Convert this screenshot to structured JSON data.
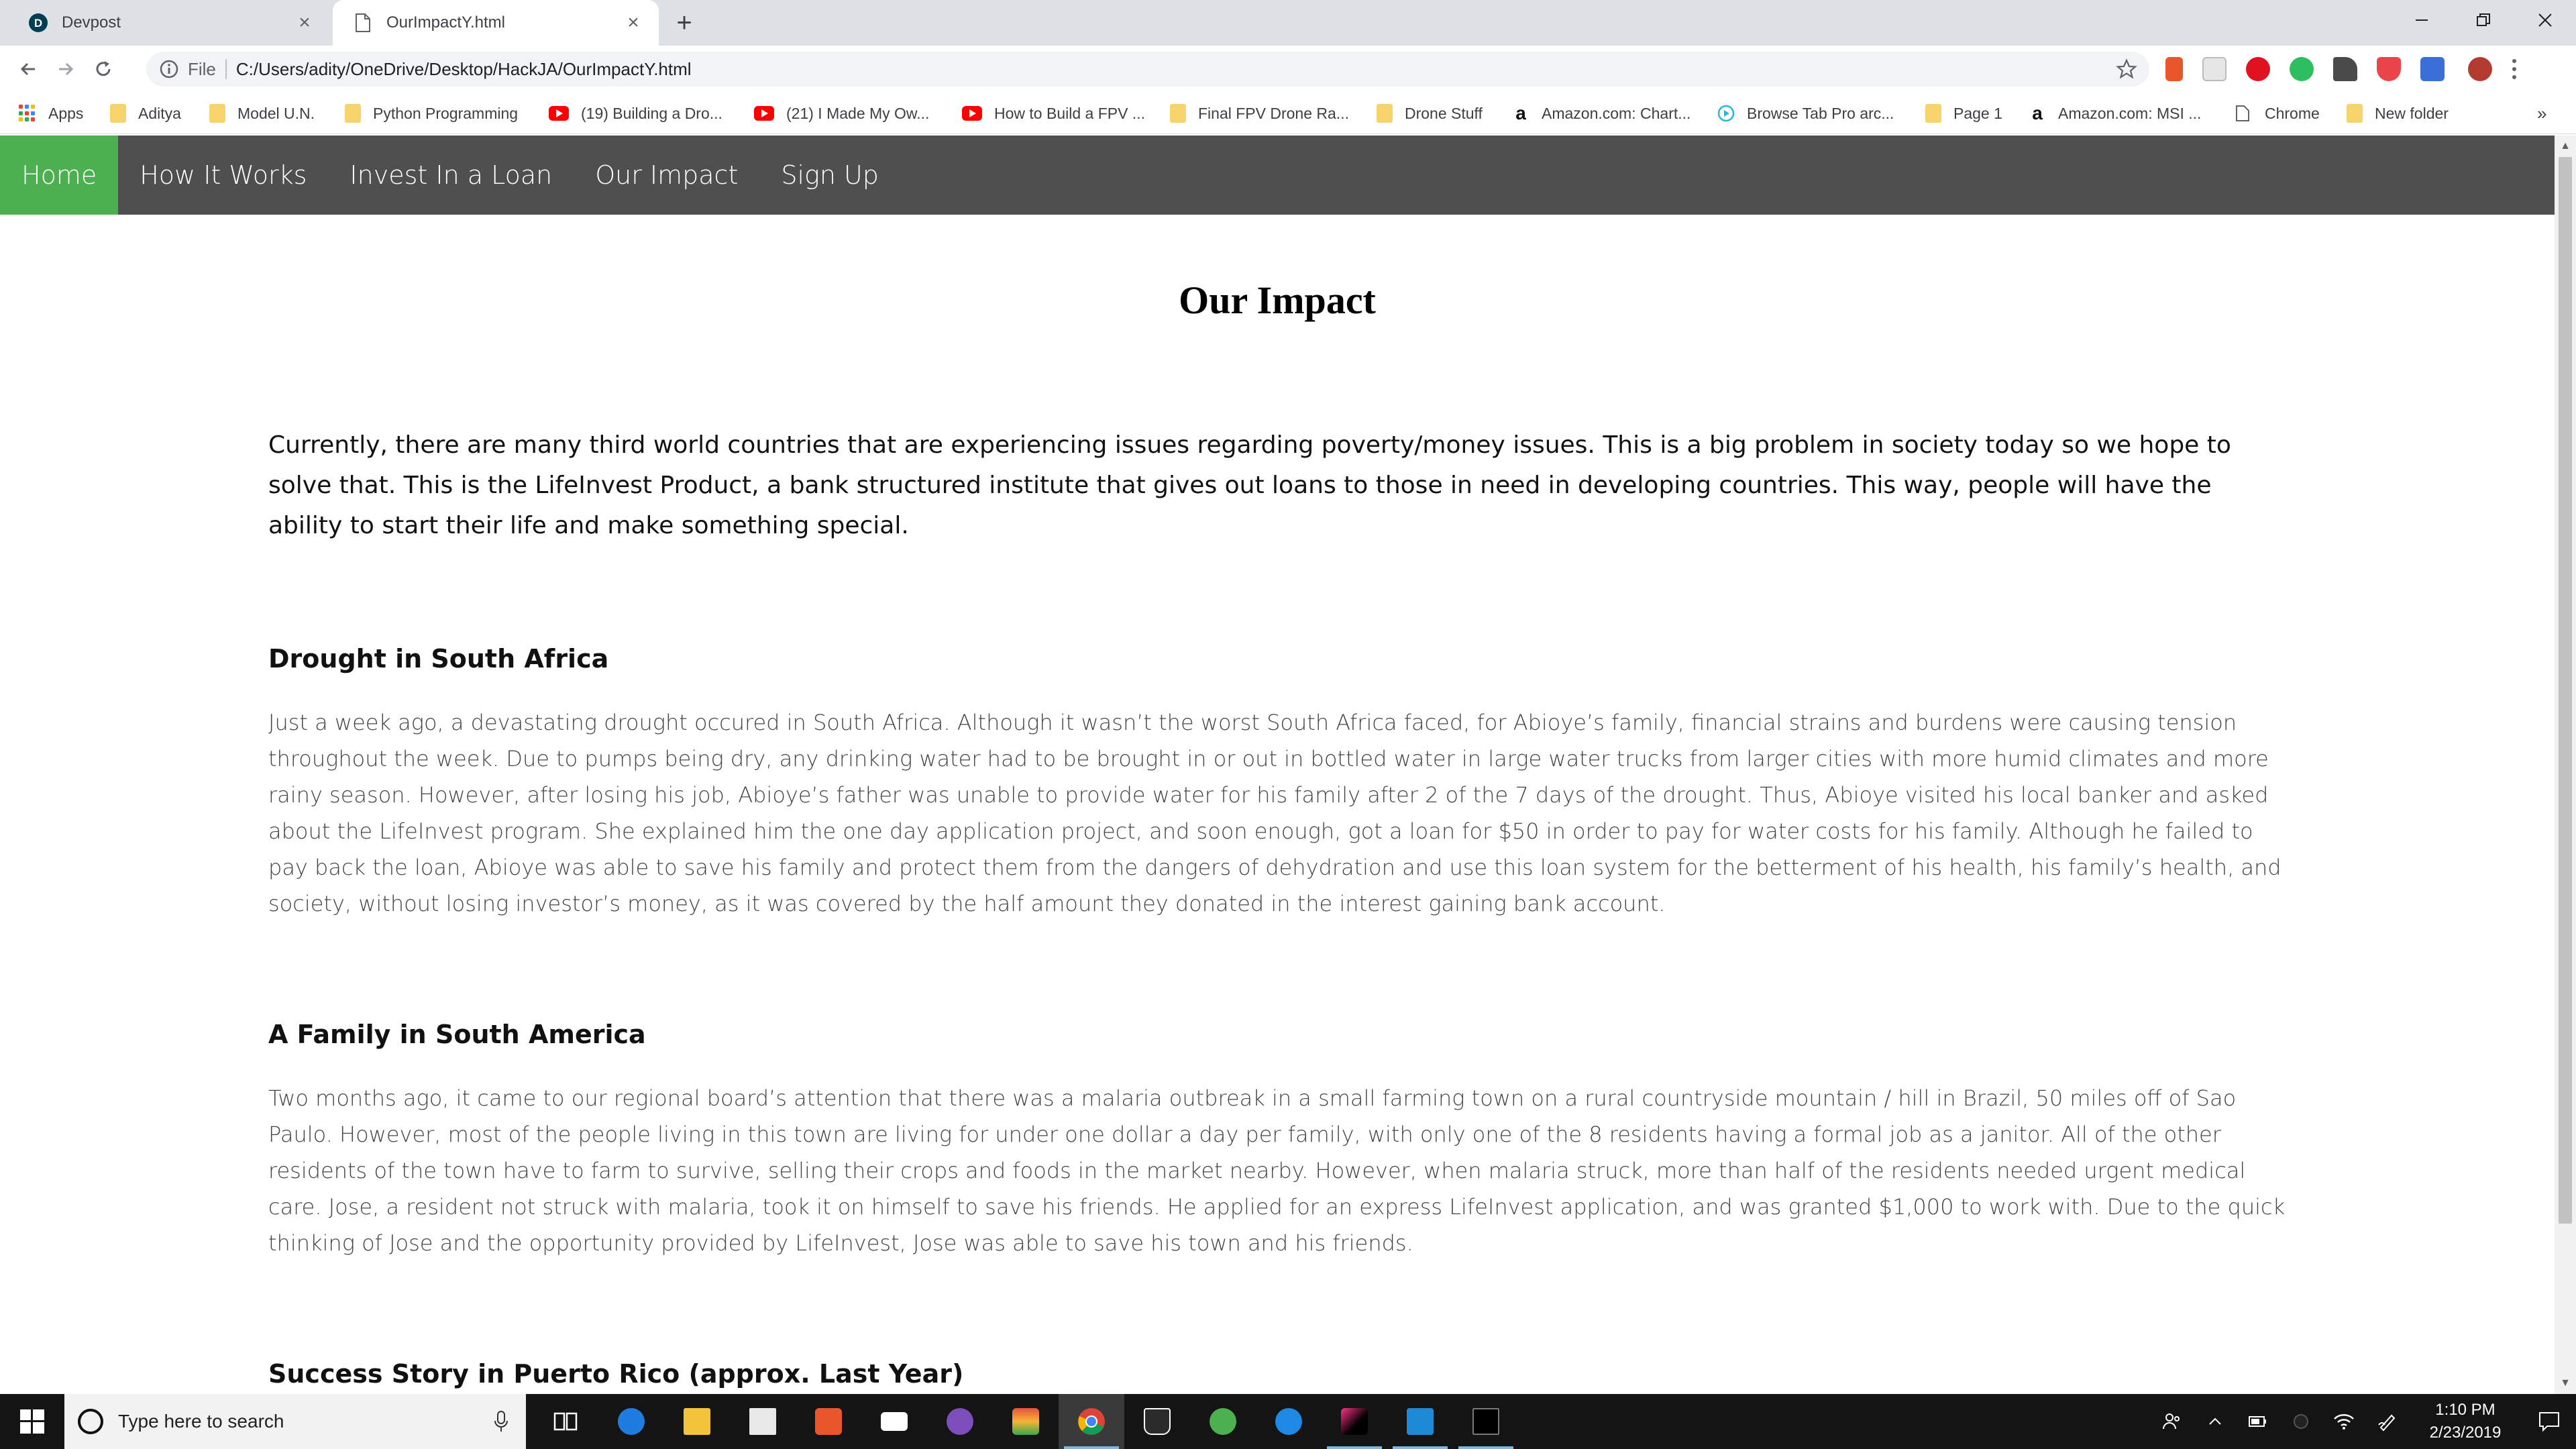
{
  "browser": {
    "tabs": [
      {
        "title": "Devpost",
        "active": false,
        "icon": "devpost-icon"
      },
      {
        "title": "OurImpactY.html",
        "active": true,
        "icon": "page-icon"
      }
    ],
    "new_tab_label": "+",
    "address": {
      "scheme": "File",
      "url": "C:/Users/adity/OneDrive/Desktop/HackJA/OurImpactY.html"
    },
    "bookmarks": [
      {
        "label": "Apps",
        "icon": "apps-grid-icon"
      },
      {
        "label": "Aditya",
        "icon": "folder-icon"
      },
      {
        "label": "Model U.N.",
        "icon": "folder-icon"
      },
      {
        "label": "Python Programming",
        "icon": "folder-icon"
      },
      {
        "label": "(19) Building a Dro...",
        "icon": "youtube-icon"
      },
      {
        "label": "(21) I Made My Ow...",
        "icon": "youtube-icon"
      },
      {
        "label": "How to Build a FPV ...",
        "icon": "youtube-icon"
      },
      {
        "label": "Final FPV Drone Ra...",
        "icon": "folder-icon"
      },
      {
        "label": "Drone Stuff",
        "icon": "folder-icon"
      },
      {
        "label": "Amazon.com: Chart...",
        "icon": "amazon-icon"
      },
      {
        "label": "Browse Tab Pro arc...",
        "icon": "play-circle-icon"
      },
      {
        "label": "Page 1",
        "icon": "folder-icon"
      },
      {
        "label": "Amazon.com: MSI ...",
        "icon": "amazon-icon"
      },
      {
        "label": "Chrome",
        "icon": "page-icon"
      },
      {
        "label": "New folder",
        "icon": "folder-icon"
      }
    ],
    "bookmarks_overflow": "»"
  },
  "site": {
    "nav": [
      {
        "label": "Home",
        "active": true
      },
      {
        "label": "How It Works",
        "active": false
      },
      {
        "label": "Invest In a Loan",
        "active": false
      },
      {
        "label": "Our Impact",
        "active": false
      },
      {
        "label": "Sign Up",
        "active": false
      }
    ],
    "title": "Our Impact",
    "intro": "Currently, there are many third world countries that are experiencing issues regarding poverty/money issues. This is a big problem in society today so we hope to solve that. This is the LifeInvest Product, a bank structured institute that gives out loans to those in need in developing countries. This way, people will have the ability to start their life and make something special.",
    "sections": [
      {
        "heading": "Drought in South Africa",
        "body": "Just a week ago, a devastating drought occured in South Africa. Although it wasn’t the worst South Africa faced, for Abioye’s family, financial strains and burdens were causing tension throughout the week. Due to pumps being dry, any drinking water had to be brought in or out in bottled water in large water trucks from larger cities with more humid climates and more rainy season. However, after losing his job, Abioye’s father was unable to provide water for his family after 2 of the 7 days of the drought. Thus, Abioye visited his local banker and asked about the LifeInvest program. She explained him the one day application project, and soon enough, got a loan for $50 in order to pay for water costs for his family. Although he failed to pay back the loan, Abioye was able to save his family and protect them from the dangers of dehydration and use this loan system for the betterment of his health, his family’s health, and society, without losing investor’s money, as it was covered by the half amount they donated in the interest gaining bank account."
      },
      {
        "heading": "A Family in South America",
        "body": "Two months ago, it came to our regional board’s attention that there was a malaria outbreak in a small farming town on a rural countryside mountain / hill in Brazil, 50 miles off of Sao Paulo. However, most of the people living in this town are living for under one dollar a day per family, with only one of the 8 residents having a formal job as a janitor. All of the other residents of the town have to farm to survive, selling their crops and foods in the market nearby. However, when malaria struck, more than half of the residents needed urgent medical care. Jose, a resident not struck with malaria, took it on himself to save his friends. He applied for an express LifeInvest application, and was granted $1,000 to work with. Due to the quick thinking of Jose and the opportunity provided by LifeInvest, Jose was able to save his town and his friends."
      },
      {
        "heading": "Success Story in Puerto Rico (approx. Last Year)",
        "body": ""
      }
    ]
  },
  "taskbar": {
    "search_placeholder": "Type here to search",
    "apps": [
      "task-view-icon",
      "edge-icon",
      "file-explorer-icon",
      "store-icon",
      "office-icon",
      "mail-icon",
      "github-icon",
      "layers-icon",
      "chrome-icon",
      "epic-games-icon",
      "globe-icon",
      "compass-icon",
      "jetbrains-icon",
      "vscode-icon",
      "terminal-icon"
    ],
    "time": "1:10 PM",
    "date": "2/23/2019"
  },
  "colors": {
    "nav_bg": "#4f4f4f",
    "nav_active": "#4caf50",
    "tab_strip": "#dee1e6",
    "taskbar": "#141414"
  }
}
